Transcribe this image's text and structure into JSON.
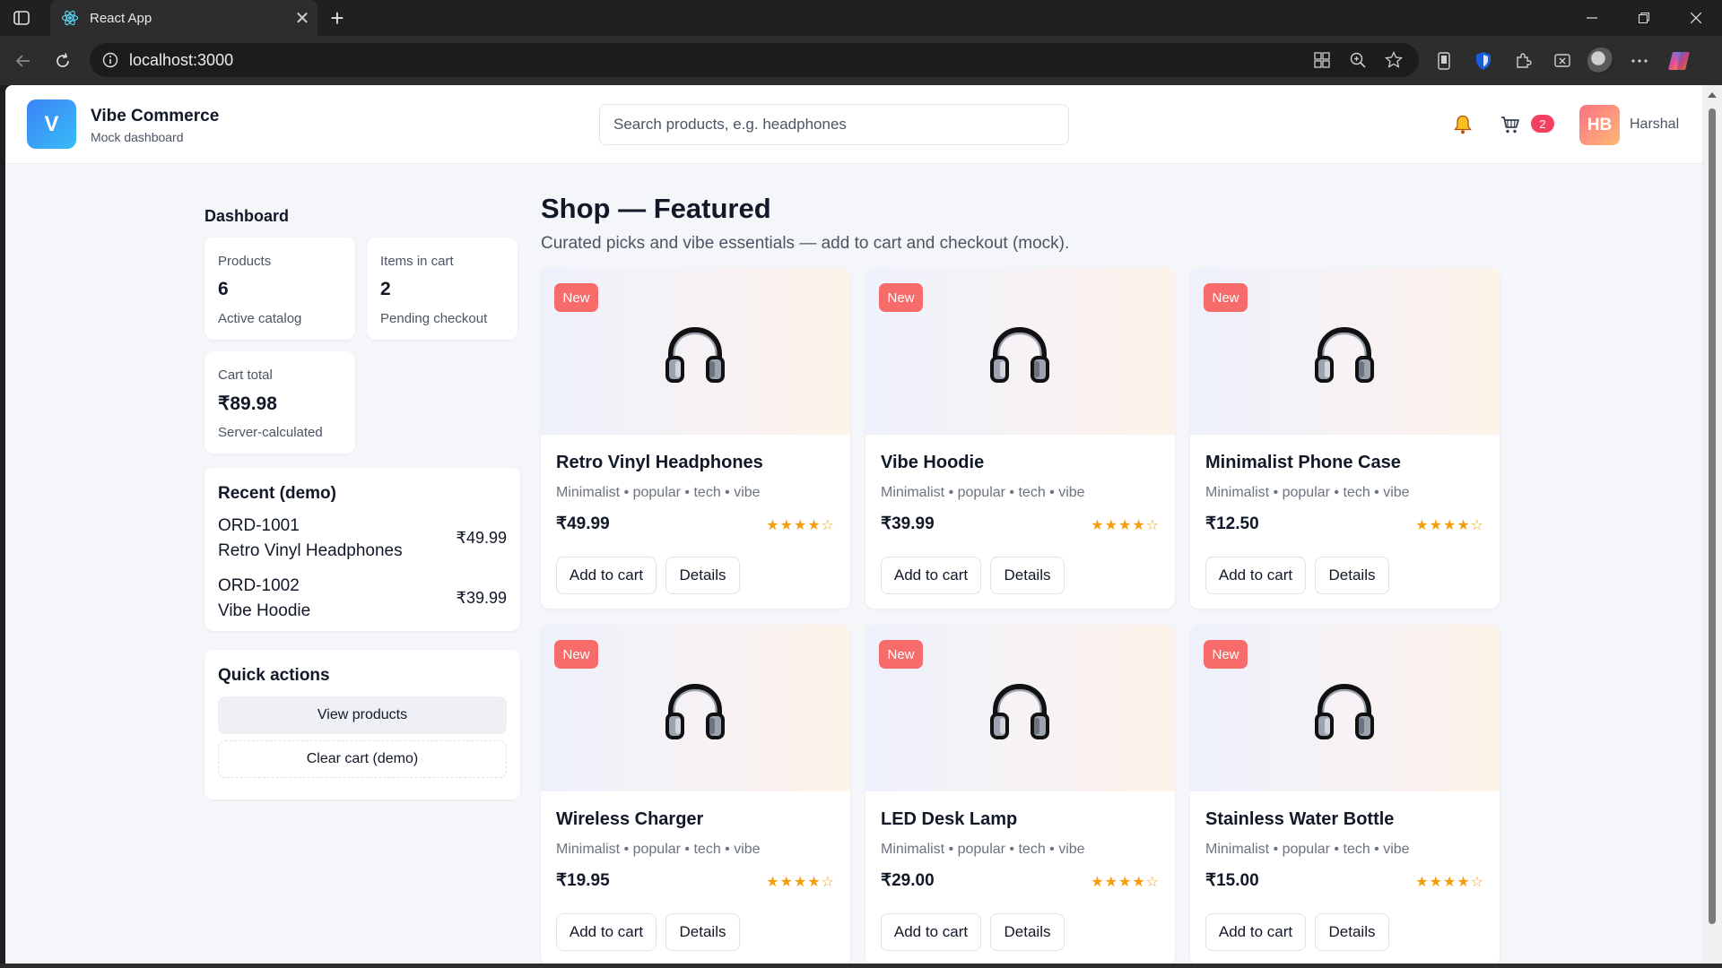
{
  "browser": {
    "tab_title": "React App",
    "url": "localhost:3000"
  },
  "header": {
    "logo_letter": "V",
    "brand": "Vibe Commerce",
    "subtitle": "Mock dashboard",
    "search_placeholder": "Search products, e.g. headphones",
    "cart_count": "2",
    "avatar_initials": "HB",
    "user_name": "Harshal"
  },
  "sidebar": {
    "title": "Dashboard",
    "stats": [
      {
        "label": "Products",
        "value": "6",
        "sub": "Active catalog"
      },
      {
        "label": "Items in cart",
        "value": "2",
        "sub": "Pending checkout"
      },
      {
        "label": "Cart total",
        "value": "₹89.98",
        "sub": "Server-calculated"
      }
    ],
    "recent": {
      "title": "Recent (demo)",
      "orders": [
        {
          "id": "ORD-1001",
          "name": "Retro Vinyl Headphones",
          "price": "₹49.99"
        },
        {
          "id": "ORD-1002",
          "name": "Vibe Hoodie",
          "price": "₹39.99"
        }
      ]
    },
    "quick_actions": {
      "title": "Quick actions",
      "view_products": "View products",
      "clear_cart": "Clear cart (demo)"
    }
  },
  "main": {
    "title": "Shop — Featured",
    "subtitle": "Curated picks and vibe essentials — add to cart and checkout (mock).",
    "products": [
      {
        "badge": "New",
        "name": "Retro Vinyl Headphones",
        "tags": "Minimalist • popular • tech • vibe",
        "price": "₹49.99",
        "stars": "★★★★☆",
        "rating": 4,
        "add_label": "Add to cart",
        "details_label": "Details"
      },
      {
        "badge": "New",
        "name": "Vibe Hoodie",
        "tags": "Minimalist • popular • tech • vibe",
        "price": "₹39.99",
        "stars": "★★★★☆",
        "rating": 4,
        "add_label": "Add to cart",
        "details_label": "Details"
      },
      {
        "badge": "New",
        "name": "Minimalist Phone Case",
        "tags": "Minimalist • popular • tech • vibe",
        "price": "₹12.50",
        "stars": "★★★★☆",
        "rating": 4,
        "add_label": "Add to cart",
        "details_label": "Details"
      },
      {
        "badge": "New",
        "name": "Wireless Charger",
        "tags": "Minimalist • popular • tech • vibe",
        "price": "₹19.95",
        "stars": "★★★★☆",
        "rating": 4,
        "add_label": "Add to cart",
        "details_label": "Details"
      },
      {
        "badge": "New",
        "name": "LED Desk Lamp",
        "tags": "Minimalist • popular • tech • vibe",
        "price": "₹29.00",
        "stars": "★★★★☆",
        "rating": 4,
        "add_label": "Add to cart",
        "details_label": "Details"
      },
      {
        "badge": "New",
        "name": "Stainless Water Bottle",
        "tags": "Minimalist • popular • tech • vibe",
        "price": "₹15.00",
        "stars": "★★★★☆",
        "rating": 4,
        "add_label": "Add to cart",
        "details_label": "Details"
      }
    ]
  },
  "colors": {
    "accent": "#3b82f6",
    "badge_new": "#f76b6b",
    "star": "#f59e0b",
    "cart_badge": "#f43f5e"
  }
}
